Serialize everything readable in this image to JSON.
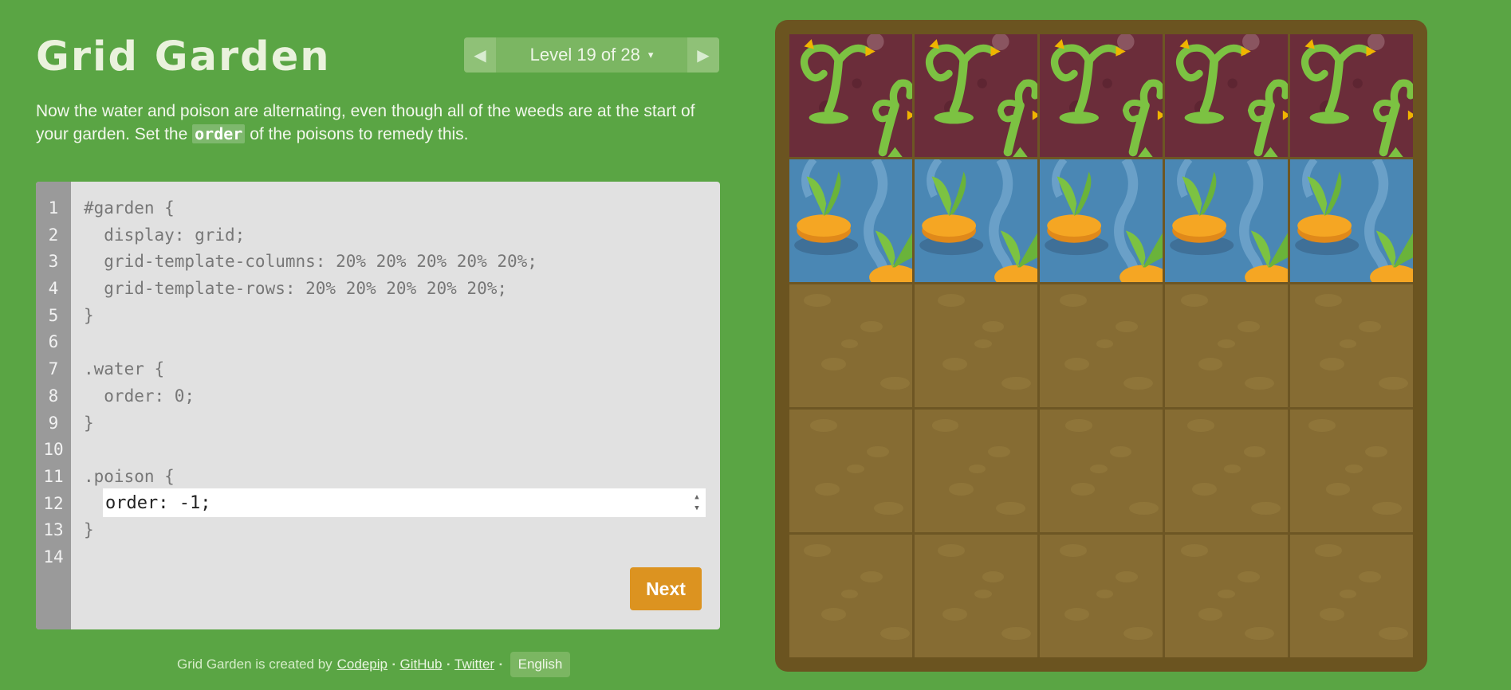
{
  "app": {
    "title": "Grid Garden"
  },
  "level_nav": {
    "label": "Level 19 of 28",
    "caret": "▾",
    "prev_glyph": "◀",
    "next_glyph": "▶"
  },
  "instructions": {
    "before": "Now the water and poison are alternating, even though all of the weeds are at the start of your garden. Set the ",
    "code": "order",
    "after": " of the poisons to remedy this."
  },
  "editor": {
    "line_numbers": [
      "1",
      "2",
      "3",
      "4",
      "5",
      "6",
      "7",
      "8",
      "9",
      "10",
      "11",
      "12",
      "13",
      "14"
    ],
    "lines": [
      "#garden {",
      "  display: grid;",
      "  grid-template-columns: 20% 20% 20% 20% 20%;",
      "  grid-template-rows: 20% 20% 20% 20% 20%;",
      "}",
      "",
      ".water {",
      "  order: 0;",
      "}",
      "",
      ".poison {",
      "",
      "}",
      ""
    ],
    "answer_value": "order: -1;",
    "spinner_up": "▲",
    "spinner_down": "▼",
    "next_label": "Next"
  },
  "footer": {
    "prefix": "Grid Garden is created by",
    "links": [
      "Codepip",
      "GitHub",
      "Twitter"
    ],
    "separator": "▪",
    "language": "English"
  },
  "garden": {
    "columns": 5,
    "rows": 5,
    "tiles": [
      "poison",
      "poison",
      "poison",
      "poison",
      "poison",
      "water",
      "water",
      "water",
      "water",
      "water",
      "soil",
      "soil",
      "soil",
      "soil",
      "soil",
      "soil",
      "soil",
      "soil",
      "soil",
      "soil",
      "soil",
      "soil",
      "soil",
      "soil",
      "soil"
    ]
  },
  "colors": {
    "background": "#5aa544",
    "next_button": "#dc9320",
    "poison_tile": "#6b2d3a",
    "water_tile": "#4a87b4",
    "soil_tile": "#866c33",
    "frame": "#6b5420"
  }
}
